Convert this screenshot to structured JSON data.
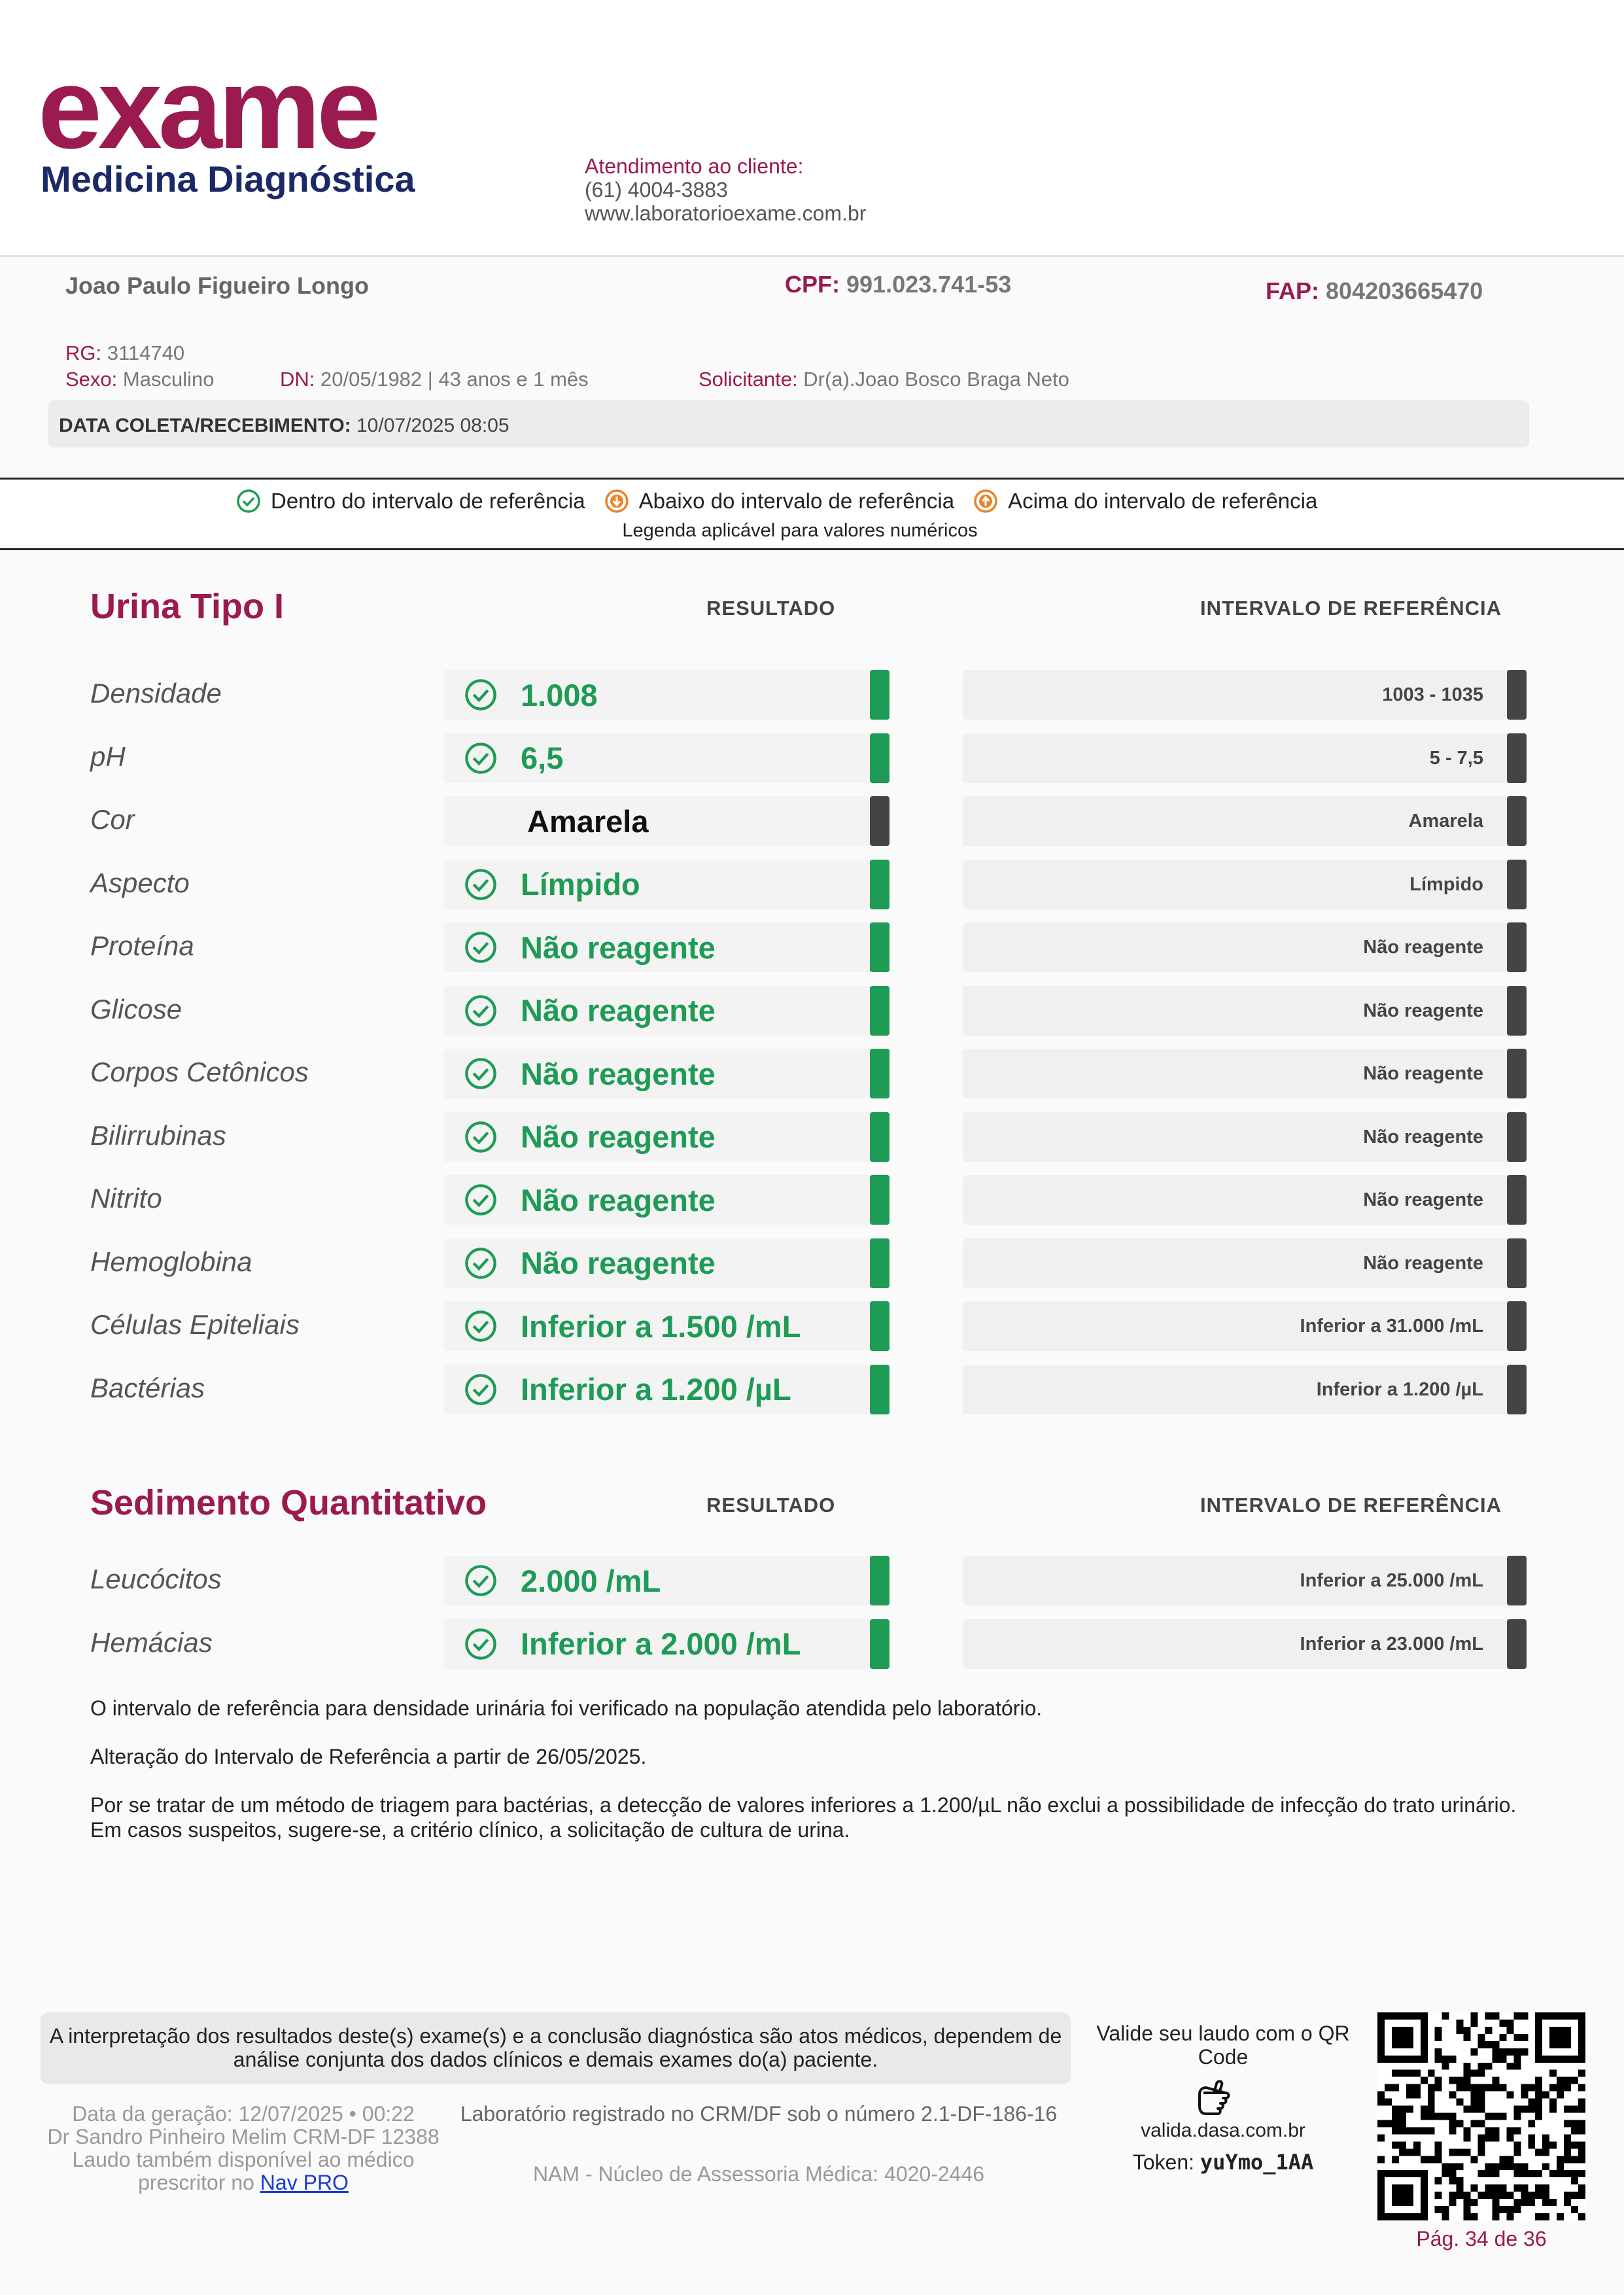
{
  "header": {
    "logo_word": "exame",
    "logo_sub": "Medicina Diagnóstica",
    "contact_title": "Atendimento ao cliente:",
    "contact_phone": "(61) 4004-3883",
    "contact_site": "www.laboratorioexame.com.br"
  },
  "patient": {
    "name": "Joao Paulo Figueiro Longo",
    "cpf_label": "CPF:",
    "cpf": "991.023.741-53",
    "fap_label": "FAP:",
    "fap": "804203665470",
    "rg_label": "RG:",
    "rg": "3114740",
    "sexo_label": "Sexo:",
    "sexo": "Masculino",
    "dn_label": "DN:",
    "dn": "20/05/1982 | 43 anos e 1 mês",
    "solicitante_label": "Solicitante:",
    "solicitante": "Dr(a).Joao Bosco Braga Neto",
    "coleta_label": "DATA COLETA/RECEBIMENTO:",
    "coleta": "10/07/2025 08:05"
  },
  "legend": {
    "within": "Dentro do intervalo de referência",
    "below": "Abaixo do intervalo de referência",
    "above": "Acima do intervalo de referência",
    "note": "Legenda aplicável para valores numéricos",
    "colors": {
      "within": "#1e9b55",
      "below": "#e8842a",
      "above": "#e8842a",
      "neutral": "#444444"
    }
  },
  "sections": {
    "urina": {
      "title": "Urina Tipo I",
      "result_head": "RESULTADO",
      "ref_head": "INTERVALO DE REFERÊNCIA",
      "rows": [
        {
          "label": "Densidade",
          "result": "1.008",
          "ref": "1003 - 1035",
          "status": "within"
        },
        {
          "label": "pH",
          "result": "6,5",
          "ref": "5 - 7,5",
          "status": "within"
        },
        {
          "label": "Cor",
          "result": "Amarela",
          "ref": "Amarela",
          "status": "neutral"
        },
        {
          "label": "Aspecto",
          "result": "Límpido",
          "ref": "Límpido",
          "status": "within"
        },
        {
          "label": "Proteína",
          "result": "Não reagente",
          "ref": "Não reagente",
          "status": "within"
        },
        {
          "label": "Glicose",
          "result": "Não reagente",
          "ref": "Não reagente",
          "status": "within"
        },
        {
          "label": "Corpos Cetônicos",
          "result": "Não reagente",
          "ref": "Não reagente",
          "status": "within"
        },
        {
          "label": "Bilirrubinas",
          "result": "Não reagente",
          "ref": "Não reagente",
          "status": "within"
        },
        {
          "label": "Nitrito",
          "result": "Não reagente",
          "ref": "Não reagente",
          "status": "within"
        },
        {
          "label": "Hemoglobina",
          "result": "Não reagente",
          "ref": "Não reagente",
          "status": "within"
        },
        {
          "label": "Células Epiteliais",
          "result": "Inferior a 1.500 /mL",
          "ref": "Inferior a 31.000 /mL",
          "status": "within"
        },
        {
          "label": "Bactérias",
          "result": "Inferior a 1.200 /µL",
          "ref": "Inferior a 1.200 /µL",
          "status": "within"
        }
      ]
    },
    "sedimento": {
      "title": "Sedimento Quantitativo",
      "result_head": "RESULTADO",
      "ref_head": "INTERVALO DE REFERÊNCIA",
      "rows": [
        {
          "label": "Leucócitos",
          "result": "2.000 /mL",
          "ref": "Inferior a 25.000 /mL",
          "status": "within"
        },
        {
          "label": "Hemácias",
          "result": "Inferior a 2.000 /mL",
          "ref": "Inferior a 23.000 /mL",
          "status": "within"
        }
      ]
    }
  },
  "notes": [
    "O intervalo de referência para densidade urinária foi verificado na população atendida pelo laboratório.",
    "Alteração do Intervalo de Referência a partir de 26/05/2025.",
    "Por se tratar de um método de triagem para bactérias, a detecção de valores inferiores a 1.200/µL não exclui a possibilidade de infecção do trato urinário. Em casos suspeitos, sugere-se, a critério clínico, a solicitação de cultura de urina."
  ],
  "footer": {
    "disclaimer": "A interpretação dos resultados deste(s) exame(s) e a conclusão diagnóstica são atos médicos, dependem de análise conjunta dos dados clínicos e demais exames do(a) paciente.",
    "generation": "Data da geração: 12/07/2025 • 00:22",
    "doctor": "Dr Sandro Pinheiro Melim CRM-DF 12388",
    "available": "Laudo também disponível ao médico prescritor no",
    "nav_link": "Nav PRO",
    "lab_registry": "Laboratório registrado no CRM/DF sob o número 2.1-DF-186-16",
    "nam": "NAM - Núcleo de Assessoria Médica: 4020-2446",
    "validate_text": "Valide seu laudo com o QR Code",
    "validate_url": "valida.dasa.com.br",
    "token_label": "Token:",
    "token": "yuYmo_1AA",
    "page": "Pág. 34 de 36",
    "qr_icon": "qr-code"
  }
}
